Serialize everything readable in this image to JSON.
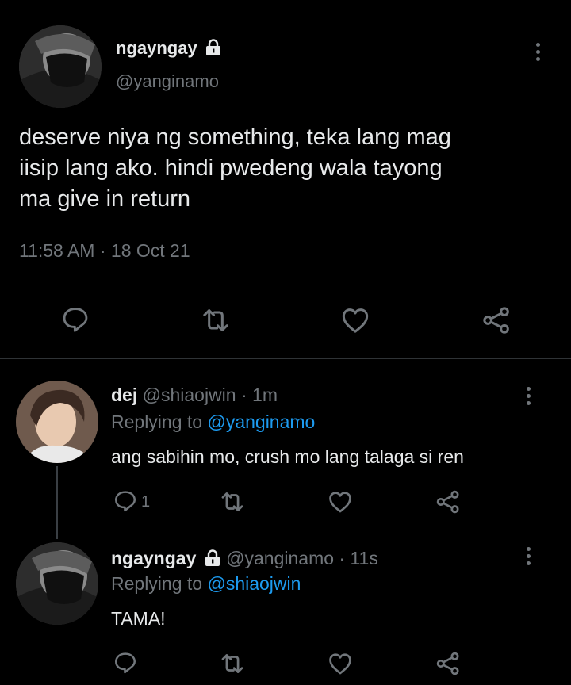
{
  "main_tweet": {
    "display_name": "ngayngay",
    "handle": "@yanginamo",
    "text_lines": [
      "deserve niya ng something, teka lang mag",
      "iisip lang ako. hindi pwedeng wala tayong",
      "ma give in return"
    ],
    "timestamp": "11:58 AM · 18 Oct 21",
    "actions": [
      "reply-icon",
      "retweet-icon",
      "like-icon",
      "share-icon"
    ]
  },
  "replies": [
    {
      "display_name": "dej",
      "handle": "@shiaojwin",
      "time": "· 1m",
      "replying_label": "Replying to",
      "replying_to": "@yanginamo",
      "text": "ang sabihin mo, crush mo lang talaga si ren",
      "reply_count": "1"
    },
    {
      "display_name": "ngayngay",
      "handle": "@yanginamo",
      "time": "· 11s",
      "replying_label": "Replying to",
      "replying_to": "@shiaojwin",
      "text": "TAMA!",
      "reply_count": ""
    }
  ],
  "colors": {
    "background": "#000000",
    "text": "#e7e9ea",
    "muted": "#71767b",
    "link": "#1d9bf0",
    "divider": "#2f3336"
  }
}
